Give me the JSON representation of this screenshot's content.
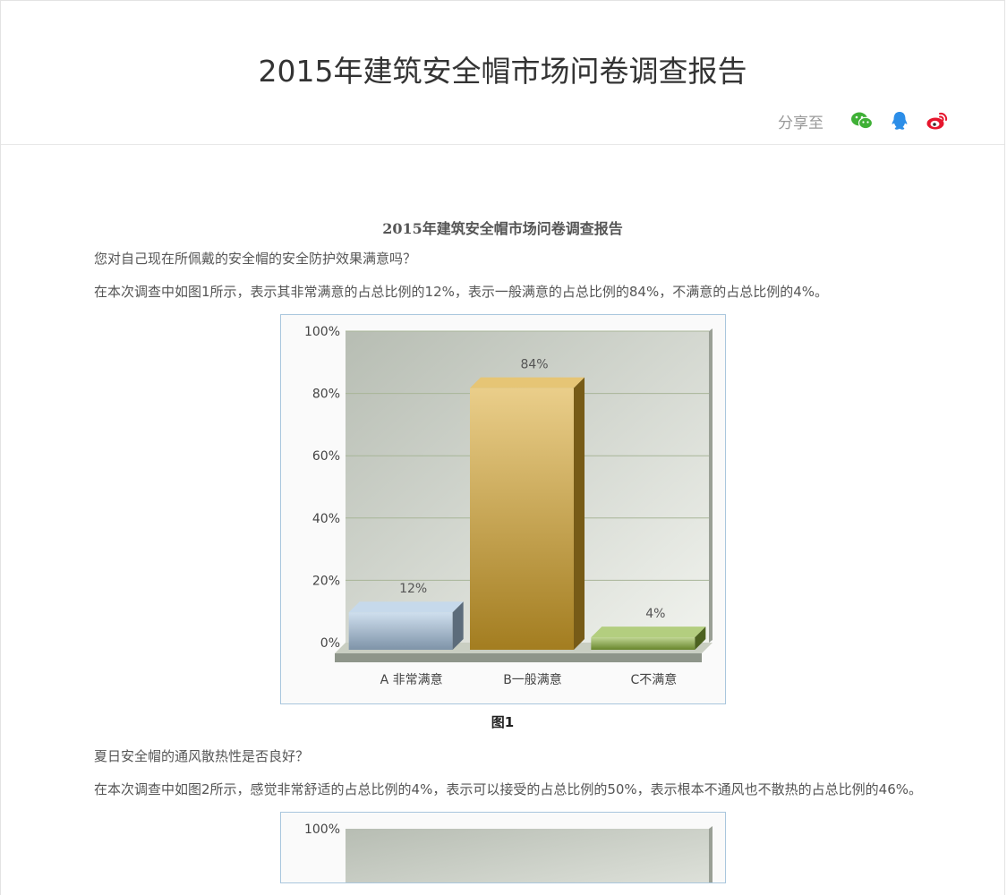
{
  "header": {
    "title": "2015年建筑安全帽市场问卷调查报告",
    "share_label": "分享至",
    "share_icons": [
      "wechat-icon",
      "qq-icon",
      "weibo-icon"
    ],
    "colors": {
      "wechat": "#3fb036",
      "qq": "#2c8ee8",
      "weibo": "#e6162d"
    }
  },
  "article": {
    "title": "2015年建筑安全帽市场问卷调查报告",
    "q1": "您对自己现在所佩戴的安全帽的安全防护效果满意吗？",
    "p1": "在本次调查中如图1所示，表示其非常满意的占总比例的12%，表示一般满意的占总比例的84%，不满意的占总比例的4%。",
    "fig1_caption": "图1",
    "q2": "夏日安全帽的通风散热性是否良好？",
    "p2": "在本次调查中如图2所示，感觉非常舒适的占总比例的4%，表示可以接受的占总比例的50%，表示根本不通风也不散热的占总比例的46%。"
  },
  "chart_data": [
    {
      "type": "bar",
      "categories": [
        "A 非常满意",
        "B一般满意",
        "C不满意"
      ],
      "values": [
        12,
        84,
        4
      ],
      "data_labels": [
        "12%",
        "84%",
        "4%"
      ],
      "ylim": [
        0,
        100
      ],
      "yticks": [
        "0%",
        "20%",
        "40%",
        "60%",
        "80%",
        "100%"
      ],
      "colors": [
        "#a8c4e0",
        "#d9a62a",
        "#8ab33a"
      ],
      "grid": true,
      "title": "",
      "xlabel": "",
      "ylabel": ""
    },
    {
      "type": "bar",
      "yticks_visible": [
        "100%"
      ],
      "ylim": [
        0,
        100
      ],
      "title": "",
      "xlabel": "",
      "ylabel": ""
    }
  ]
}
